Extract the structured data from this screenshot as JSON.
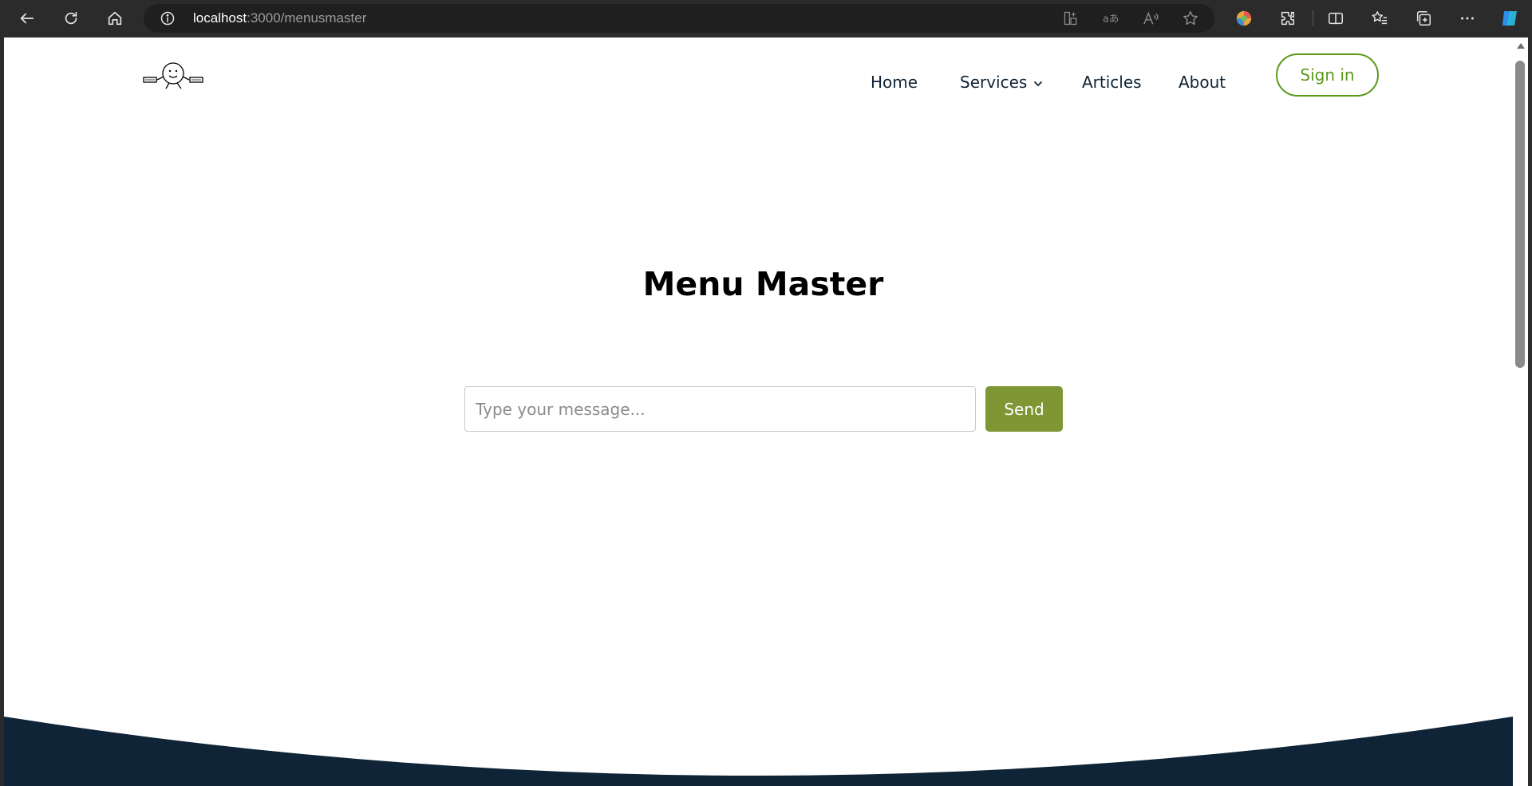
{
  "browser": {
    "url_host": "localhost",
    "url_path": ":3000/menusmaster"
  },
  "site": {
    "nav": {
      "home": "Home",
      "services": "Services",
      "articles": "Articles",
      "about": "About"
    },
    "signin_label": "Sign in"
  },
  "main": {
    "title": "Menu Master",
    "message_placeholder": "Type your message...",
    "send_label": "Send"
  },
  "colors": {
    "nav_text": "#0f2436",
    "accent_green": "#5b9a1d",
    "send_button": "#7f9634",
    "footer_navy": "#0f2436"
  }
}
